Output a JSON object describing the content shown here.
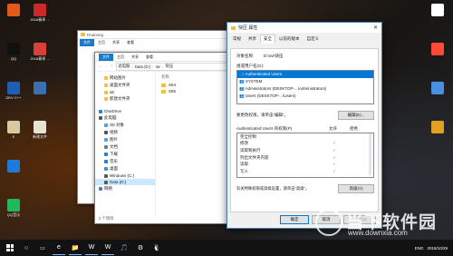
{
  "desktop": {
    "icons_left": [
      {
        "label": "",
        "color": "#e05a1b"
      },
      {
        "label": "QQ",
        "color": "#111111"
      },
      {
        "label": "DEV C++",
        "color": "#1e5fb4"
      },
      {
        "label": "E",
        "color": "#d8c9a0"
      },
      {
        "label": "",
        "color": "#1e7bd8"
      },
      {
        "label": "QQ音乐",
        "color": "#20b85a"
      }
    ],
    "icons_col2": [
      {
        "label": "2018春季 ...",
        "color": "#cc2a2a"
      },
      {
        "label": "2018春季 ...",
        "color": "#d8403a"
      },
      {
        "label": "",
        "color": "#3a6fb0"
      },
      {
        "label": "新建文件",
        "color": "#e7e2d2"
      }
    ],
    "icons_right": [
      {
        "label": "",
        "color": "#ffffff"
      },
      {
        "label": "",
        "color": "#ff4a3a"
      },
      {
        "label": "",
        "color": "#4a90e2"
      },
      {
        "label": "",
        "color": "#e0a020"
      }
    ]
  },
  "explorer_back": {
    "title": "Roaming",
    "tabs": [
      "文件",
      "主页",
      "共享",
      "查看"
    ]
  },
  "explorer": {
    "ribbon_tabs": [
      "文件",
      "主页",
      "共享",
      "查看"
    ],
    "breadcrumb": [
      "此电脑",
      "Data (D:)",
      "rar",
      "快压"
    ],
    "column_header": "名称",
    "files": [
      "X64",
      "X86"
    ],
    "nav_top": [
      "网站图片",
      "桌面文件夹",
      "ab",
      "新建文件夹"
    ],
    "nav_items": [
      {
        "label": "OneDrive",
        "color": "#1e88e5"
      },
      {
        "label": "此电脑",
        "color": "#555555"
      },
      {
        "label": "3D 对象",
        "color": "#4aa3df"
      },
      {
        "label": "视频",
        "color": "#555555"
      },
      {
        "label": "图片",
        "color": "#4aa3df"
      },
      {
        "label": "文档",
        "color": "#777777"
      },
      {
        "label": "下载",
        "color": "#2a7fd4"
      },
      {
        "label": "音乐",
        "color": "#2a7fd4"
      },
      {
        "label": "桌面",
        "color": "#3a8fd8"
      },
      {
        "label": "Windows (C:)",
        "color": "#5a5a5a"
      },
      {
        "label": "Data (D:)",
        "color": "#5a5a5a"
      },
      {
        "label": "网络",
        "color": "#4a7fb5"
      }
    ],
    "status": "2 个项目"
  },
  "dialog": {
    "title": "快压 属性",
    "tabs": [
      "常规",
      "共享",
      "安全",
      "以前的版本",
      "自定义"
    ],
    "object_name_label": "对象名称:",
    "object_name_value": "D:\\rar\\快压",
    "groups_label": "组或用户名(G):",
    "groups": [
      "Authenticated Users",
      "SYSTEM",
      "Administrators (DESKTOP-...\\Administrators)",
      "Users (DESKTOP-...\\Users)"
    ],
    "change_hint": "要更改权限，请单击“编辑”。",
    "edit_button": "编辑(E)...",
    "perm_for": "Authenticated Users 的权限(P)",
    "allow": "允许",
    "deny": "拒绝",
    "permissions": [
      {
        "name": "完全控制",
        "allow": ""
      },
      {
        "name": "修改",
        "allow": "✓"
      },
      {
        "name": "读取和执行",
        "allow": "✓"
      },
      {
        "name": "列出文件夹内容",
        "allow": "✓"
      },
      {
        "name": "读取",
        "allow": "✓"
      },
      {
        "name": "写入",
        "allow": "✓"
      }
    ],
    "advanced_hint": "有关特殊权限或高级设置，请单击“高级”。",
    "advanced_button": "高级(V)",
    "ok": "确定",
    "cancel": "取消",
    "apply": "应用(A)"
  },
  "taskbar": {
    "apps": [
      "e",
      "📁",
      "W",
      "W",
      "🎵",
      "⚙",
      "🐧"
    ],
    "tray_text": "ENG",
    "time": "2018/10/29"
  },
  "watermark": {
    "brand": "当下软件园",
    "url": "www.downxia.com"
  },
  "colors": {
    "selection": "#0078d7",
    "ribbon_accent": "#1979ca"
  }
}
